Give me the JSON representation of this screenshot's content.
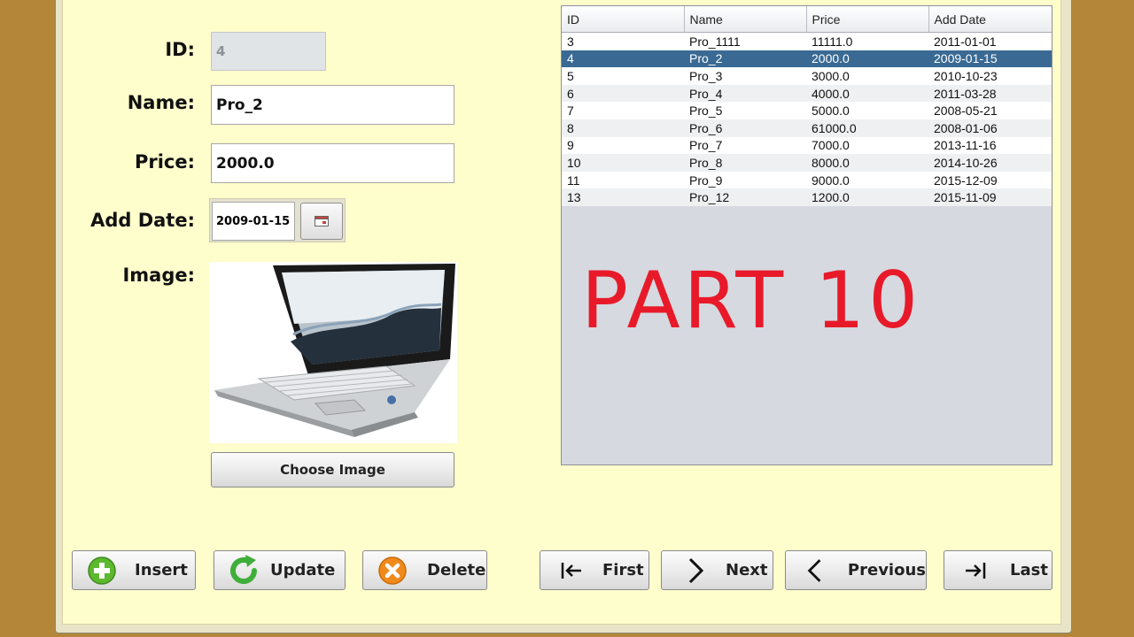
{
  "form": {
    "id_label": "ID:",
    "id_value": "4",
    "name_label": "Name:",
    "name_value": "Pro_2",
    "price_label": "Price:",
    "price_value": "2000.0",
    "date_label": "Add Date:",
    "date_value": "2009-01-15",
    "image_label": "Image:",
    "choose_image_label": "Choose Image"
  },
  "table": {
    "columns": [
      "ID",
      "Name",
      "Price",
      "Add Date"
    ],
    "rows": [
      [
        "3",
        "Pro_1111",
        "11111.0",
        "2011-01-01"
      ],
      [
        "4",
        "Pro_2",
        "2000.0",
        "2009-01-15"
      ],
      [
        "5",
        "Pro_3",
        "3000.0",
        "2010-10-23"
      ],
      [
        "6",
        "Pro_4",
        "4000.0",
        "2011-03-28"
      ],
      [
        "7",
        "Pro_5",
        "5000.0",
        "2008-05-21"
      ],
      [
        "8",
        "Pro_6",
        "61000.0",
        "2008-01-06"
      ],
      [
        "9",
        "Pro_7",
        "7000.0",
        "2013-11-16"
      ],
      [
        "10",
        "Pro_8",
        "8000.0",
        "2014-10-26"
      ],
      [
        "11",
        "Pro_9",
        "9000.0",
        "2015-12-09"
      ],
      [
        "13",
        "Pro_12",
        "1200.0",
        "2015-11-09"
      ]
    ],
    "selected_row_index": 1
  },
  "actions": {
    "insert": "Insert",
    "update": "Update",
    "delete": "Delete"
  },
  "navigation": {
    "first": "First",
    "next": "Next",
    "previous": "Previous",
    "last": "Last"
  },
  "overlay_text": "PART 10",
  "colors": {
    "background": "#b3863a",
    "panel": "#fefdcc",
    "selection": "#3a6a93",
    "overlay": "#e81a2a",
    "insert_icon": "#5cb82e",
    "update_icon": "#3fae3a",
    "delete_icon": "#f08a1c"
  },
  "icons": {
    "insert": "plus-circle-icon",
    "update": "refresh-icon",
    "delete": "x-circle-icon",
    "first": "first-arrow-icon",
    "next": "chevron-right-icon",
    "previous": "chevron-left-icon",
    "last": "last-arrow-icon",
    "calendar": "calendar-icon"
  }
}
